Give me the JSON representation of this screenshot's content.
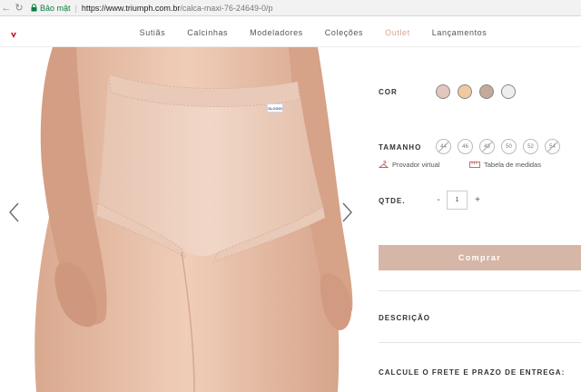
{
  "browser": {
    "secure_label": "Bảo mật",
    "url_host": "https://www.triumph.com.br",
    "url_path": "/calca-maxi-76-24649-0/p"
  },
  "menu": {
    "items": [
      "Sutiãs",
      "Calcinhas",
      "Modeladores",
      "Coleções",
      "Outlet",
      "Lançamentos"
    ]
  },
  "product": {
    "brief_tag": "SLOGGI",
    "color_label": "COR",
    "colors": [
      "#e3c7bd",
      "#f0c9a0",
      "#c3aa9a",
      "#eeeeee"
    ],
    "size_label": "TAMANHO",
    "sizes": [
      "44",
      "46",
      "48",
      "50",
      "52",
      "54"
    ],
    "sizes_unavailable": [
      "44",
      "48",
      "54"
    ],
    "virtual_fitting": "Provador virtual",
    "size_chart": "Tabela de medidas",
    "qty_label": "QTDE.",
    "qty_minus": "-",
    "qty_value": "1",
    "qty_plus": "+",
    "buy_label": "Comprar",
    "description_label": "DESCRIÇÃO",
    "shipping_label": "CALCULE O FRETE E PRAZO DE ENTREGA:"
  },
  "colors": {
    "buy_button": "#d6b6a6",
    "outlet_link": "#d9a48d"
  }
}
